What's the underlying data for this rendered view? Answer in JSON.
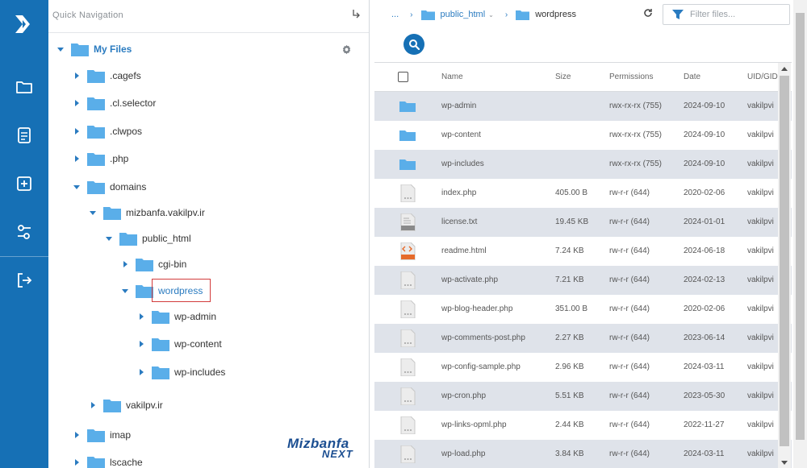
{
  "sidebar": {
    "items": [
      {
        "icon": "folder-icon"
      },
      {
        "icon": "file-icon"
      },
      {
        "icon": "new-file-icon"
      },
      {
        "icon": "settings-sliders-icon"
      },
      {
        "icon": "logout-icon"
      }
    ]
  },
  "tree": {
    "header": "Quick Navigation",
    "root": "My Files",
    "nodes": [
      {
        "label": ".cagefs",
        "expanded": false
      },
      {
        "label": ".cl.selector",
        "expanded": false
      },
      {
        "label": ".clwpos",
        "expanded": false
      },
      {
        "label": ".php",
        "expanded": false
      },
      {
        "label": "domains",
        "expanded": true
      },
      {
        "label": "mizbanfa.vakilpv.ir",
        "expanded": true
      },
      {
        "label": "public_html",
        "expanded": true
      },
      {
        "label": "cgi-bin",
        "expanded": false
      },
      {
        "label": "wordpress",
        "expanded": true,
        "selected": true
      },
      {
        "label": "wp-admin",
        "expanded": false
      },
      {
        "label": "wp-content",
        "expanded": false
      },
      {
        "label": "wp-includes",
        "expanded": false
      },
      {
        "label": "vakilpv.ir",
        "expanded": false
      },
      {
        "label": "imap",
        "expanded": false
      },
      {
        "label": "lscache",
        "expanded": false
      }
    ],
    "brand": {
      "line1": "Mizbanfa",
      "line2": "NEXT"
    }
  },
  "breadcrumb": {
    "ellipsis": "...",
    "parent": "public_html",
    "current": "wordpress"
  },
  "filter": {
    "placeholder": "Filter files..."
  },
  "table": {
    "headers": {
      "name": "Name",
      "size": "Size",
      "permissions": "Permissions",
      "date": "Date",
      "uid": "UID/GID"
    },
    "rows": [
      {
        "type": "folder",
        "name": "wp-admin",
        "size": "",
        "perm": "rwx-rx-rx (755)",
        "date": "2024-09-10",
        "uid": "vakilpvi"
      },
      {
        "type": "folder",
        "name": "wp-content",
        "size": "",
        "perm": "rwx-rx-rx (755)",
        "date": "2024-09-10",
        "uid": "vakilpvi"
      },
      {
        "type": "folder",
        "name": "wp-includes",
        "size": "",
        "perm": "rwx-rx-rx (755)",
        "date": "2024-09-10",
        "uid": "vakilpvi"
      },
      {
        "type": "file",
        "name": "index.php",
        "size": "405.00 B",
        "perm": "rw-r-r (644)",
        "date": "2020-02-06",
        "uid": "vakilpvi"
      },
      {
        "type": "txt",
        "name": "license.txt",
        "size": "19.45 KB",
        "perm": "rw-r-r (644)",
        "date": "2024-01-01",
        "uid": "vakilpvi"
      },
      {
        "type": "html",
        "name": "readme.html",
        "size": "7.24 KB",
        "perm": "rw-r-r (644)",
        "date": "2024-06-18",
        "uid": "vakilpvi"
      },
      {
        "type": "file",
        "name": "wp-activate.php",
        "size": "7.21 KB",
        "perm": "rw-r-r (644)",
        "date": "2024-02-13",
        "uid": "vakilpvi"
      },
      {
        "type": "file",
        "name": "wp-blog-header.php",
        "size": "351.00 B",
        "perm": "rw-r-r (644)",
        "date": "2020-02-06",
        "uid": "vakilpvi"
      },
      {
        "type": "file",
        "name": "wp-comments-post.php",
        "size": "2.27 KB",
        "perm": "rw-r-r (644)",
        "date": "2023-06-14",
        "uid": "vakilpvi"
      },
      {
        "type": "file",
        "name": "wp-config-sample.php",
        "size": "2.96 KB",
        "perm": "rw-r-r (644)",
        "date": "2024-03-11",
        "uid": "vakilpvi"
      },
      {
        "type": "file",
        "name": "wp-cron.php",
        "size": "5.51 KB",
        "perm": "rw-r-r (644)",
        "date": "2023-05-30",
        "uid": "vakilpvi"
      },
      {
        "type": "file",
        "name": "wp-links-opml.php",
        "size": "2.44 KB",
        "perm": "rw-r-r (644)",
        "date": "2022-11-27",
        "uid": "vakilpvi"
      },
      {
        "type": "file",
        "name": "wp-load.php",
        "size": "3.84 KB",
        "perm": "rw-r-r (644)",
        "date": "2024-03-11",
        "uid": "vakilpvi"
      }
    ]
  },
  "colors": {
    "accent": "#1670b5",
    "folder": "#5aaee9",
    "row_alt": "#dfe3ea",
    "selection_box": "#d23b3b"
  }
}
